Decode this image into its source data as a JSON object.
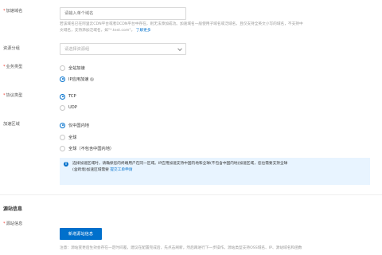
{
  "form": {
    "domain": {
      "label": "加速域名",
      "placeholder": "请输入单个域名",
      "help_line1": "若该域名已在阿里云CDN平台或者DCDN平台中存在，则无法添加成功。加速域名一般使用子域名或泛域名，且仅支持全英文小写的域名，不支持中",
      "help_line2": "文域名，支持添加泛域名，如\"*.test.com\"。",
      "help_link": "了解更多"
    },
    "resource_group": {
      "label": "资源分组",
      "placeholder": "请选择资源组"
    },
    "business_type": {
      "label": "业务类型",
      "options": [
        "全站加速",
        "IP应用加速"
      ],
      "selected_index": 1
    },
    "protocol_type": {
      "label": "协议类型",
      "options": [
        "TCP",
        "UDP"
      ],
      "selected_index": 0
    },
    "accel_region": {
      "label": "加速区域",
      "options": [
        "仅中国内地",
        "全球",
        "全球（不包含中国内地）"
      ],
      "selected_index": 0
    },
    "info": {
      "line1": "选择加速区域时，请确保您的终端用户在同一区域。IP应用加速支持中国内地和全球(不包含中国内地)加速区域，您也需要支持全球",
      "line2": "(含跨境)加速区域需要",
      "link": "提交工单申请"
    }
  },
  "origin": {
    "section_title": "源站信息",
    "label": "源站信息",
    "add_button": "新增源站信息",
    "note": "注意：源站变更后生效会存在一定时间差，建议在配置完成后，先点击刷新，然后再进行下一步操作。源站类型支持OSS域名、IP、源站域名和函数"
  },
  "colors": {
    "primary": "#0070cc",
    "required": "#f04134",
    "info_bg": "#e8f4ff"
  }
}
